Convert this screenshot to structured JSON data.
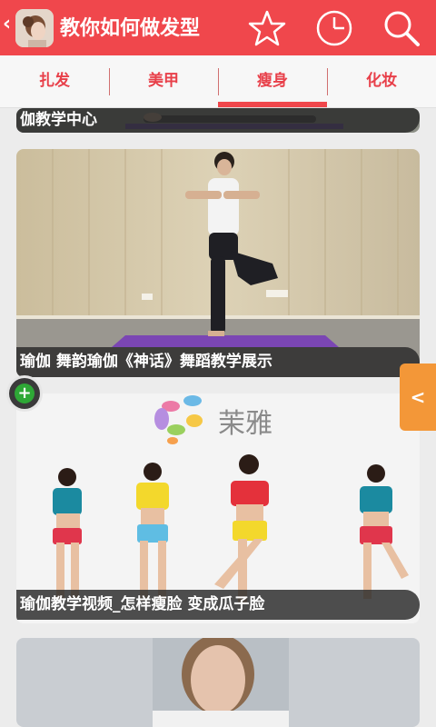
{
  "header": {
    "back_icon": "chevron-left-icon",
    "title": "教你如何做发型",
    "icons": [
      "star-icon",
      "clock-icon",
      "search-icon"
    ],
    "bg_color": "#f0474c"
  },
  "tabs": [
    {
      "label": "扎发",
      "active": false
    },
    {
      "label": "美甲",
      "active": false
    },
    {
      "label": "瘦身",
      "active": true
    },
    {
      "label": "化妆",
      "active": false
    }
  ],
  "feed": [
    {
      "caption": "伽教学中心"
    },
    {
      "caption": "瑜伽 舞韵瑜伽《神话》舞蹈教学展示"
    },
    {
      "caption": "瑜伽教学视频_怎样瘦脸 变成瓜子脸",
      "logo_text": "茉雅"
    },
    {
      "caption": ""
    }
  ],
  "fab_label": "+",
  "side_tab_label": "<"
}
